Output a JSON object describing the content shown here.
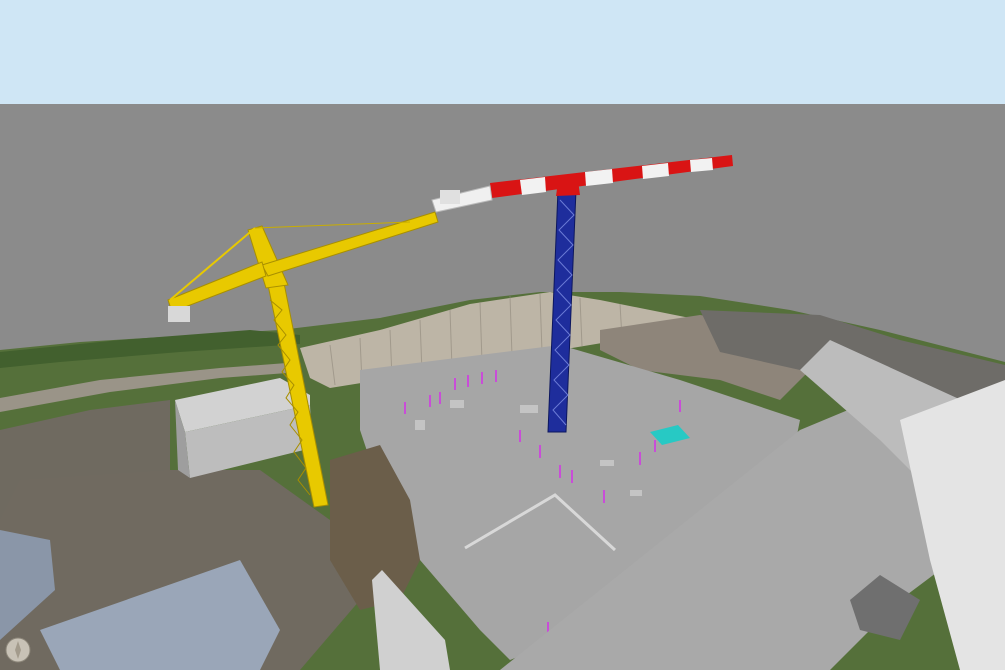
{
  "viewport": {
    "sky_color": "#cfe6f5",
    "ground_color": "#8a8a8a",
    "slab_color": "#a5a5a5",
    "building_color": "#c8c8c8",
    "terrain_green": "#4f6b35",
    "rock_color": "#b9b2a6",
    "crane_left_color": "#e8c900",
    "crane_right_mast_color": "#1e2d9c",
    "crane_right_jib_colors": [
      "#d91414",
      "#f0f0f0"
    ],
    "marker_color": "#c94dd8",
    "highlight_color": "#27c9c4"
  },
  "view_cube": {
    "icon": "compass-icon"
  }
}
